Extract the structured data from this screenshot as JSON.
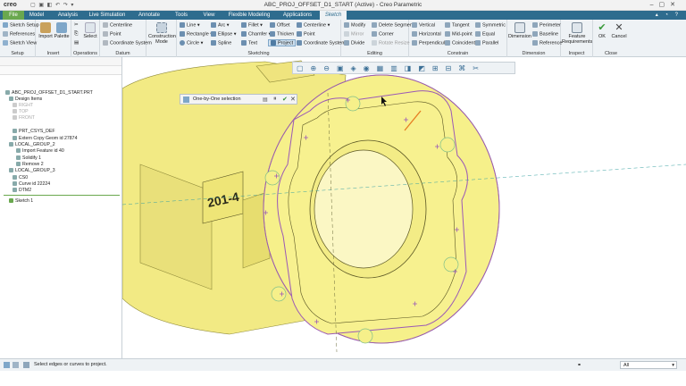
{
  "app": {
    "logo": "creo",
    "title": "ABC_PROJ_OFFSET_D1_START (Active) - Creo Parametric"
  },
  "tabs": [
    {
      "label": "File"
    },
    {
      "label": "Model"
    },
    {
      "label": "Analysis"
    },
    {
      "label": "Live Simulation"
    },
    {
      "label": "Annotate"
    },
    {
      "label": "Tools"
    },
    {
      "label": "View"
    },
    {
      "label": "Flexible Modeling"
    },
    {
      "label": "Applications"
    },
    {
      "label": "Sketch"
    }
  ],
  "ribbon": {
    "setup": {
      "label": "Setup",
      "items": [
        "Sketch Setup",
        "References",
        "Sketch View"
      ]
    },
    "insert": {
      "label": "Insert",
      "items": [
        "Import",
        "Palette"
      ]
    },
    "operations": {
      "label": "Operations",
      "items": [
        "Select"
      ]
    },
    "datum": {
      "label": "Datum",
      "items": [
        "Centerline",
        "Point",
        "Coordinate System"
      ]
    },
    "construction": {
      "label": "Construction Mode"
    },
    "sketching": {
      "label": "Sketching",
      "items": [
        "Line",
        "Arc",
        "Fillet",
        "Offset",
        "Centerline",
        "Rectangle",
        "Ellipse",
        "Chamfer",
        "Thicken",
        "Point",
        "Circle",
        "Spline",
        "Text",
        "Project",
        "Coordinate System"
      ]
    },
    "editing": {
      "label": "Editing",
      "items": [
        "Modify",
        "Delete Segment",
        "Mirror",
        "Corner",
        "Divide",
        "Rotate Resize"
      ]
    },
    "constrain": {
      "label": "Constrain",
      "items": [
        "Vertical",
        "Tangent",
        "Symmetric",
        "Horizontal",
        "Mid-point",
        "Equal",
        "Perpendicular",
        "Coincident",
        "Parallel"
      ]
    },
    "dimension": {
      "label": "Dimension",
      "items": [
        "Dimension",
        "Perimeter",
        "Baseline",
        "Reference"
      ]
    },
    "inspect": {
      "label": "Inspect",
      "items": [
        "Feature Requirements"
      ]
    },
    "close": {
      "label": "Close",
      "items": [
        "OK",
        "Cancel"
      ]
    }
  },
  "tree": [
    {
      "label": "ABC_PROJ_OFFSET_D1_START.PRT",
      "dim": false
    },
    {
      "label": "Design Items",
      "dim": false
    },
    {
      "label": "RIGHT",
      "dim": true
    },
    {
      "label": "TOP",
      "dim": true
    },
    {
      "label": "FRONT",
      "dim": true
    },
    {
      "label": "PRT_CSYS_DEF",
      "dim": false
    },
    {
      "label": "Extern Copy Geom id 27874",
      "dim": false
    },
    {
      "label": "LOCAL_GROUP_2",
      "dim": false
    },
    {
      "label": "Import Feature id 40",
      "dim": false
    },
    {
      "label": "Solidify 1",
      "dim": false
    },
    {
      "label": "Remove 2",
      "dim": false
    },
    {
      "label": "LOCAL_GROUP_3",
      "dim": false
    },
    {
      "label": "CS0",
      "dim": false
    },
    {
      "label": "Curve id 22224",
      "dim": false
    },
    {
      "label": "DTM2",
      "dim": false
    },
    {
      "label": "Sketch 1",
      "dim": false
    }
  ],
  "viewport": {
    "selection_dialog": "One-by-One selection",
    "part_text": "201-4"
  },
  "status": {
    "message": "Select edges or curves to project.",
    "filter": "All"
  },
  "colors": {
    "tab_bar": "#2e6c8e",
    "file_tab": "#6aa84f",
    "part_fill": "#f6f08a",
    "sketch_line": "#9b59b6",
    "highlight": "#e67e22"
  }
}
